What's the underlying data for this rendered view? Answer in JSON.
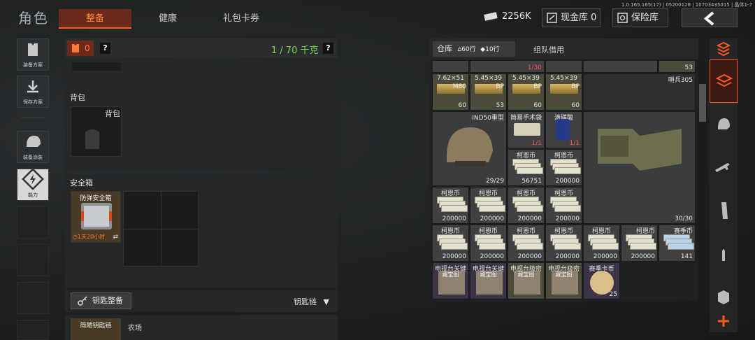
{
  "header": {
    "title": "角色",
    "tabs": [
      {
        "label": "整备",
        "active": true
      },
      {
        "label": "健康",
        "active": false
      },
      {
        "label": "礼包卡券",
        "active": false
      }
    ],
    "money": "2256K",
    "cash_vault_label": "现金库 0",
    "safe_vault_label": "保险库",
    "version": "1.0.165.165(17) | 05200128 | 10703435015 | 晶体1-7"
  },
  "left_nav": [
    {
      "label": "装备方案",
      "icon": "vest-icon"
    },
    {
      "label": "保存方案",
      "icon": "download-icon"
    },
    {
      "label": "装备涂装",
      "icon": "helmet-paint-icon"
    },
    {
      "label": "能力",
      "icon": "lightning-icon"
    }
  ],
  "loadout": {
    "armor_value": "0",
    "weight": "1 / 70 千克",
    "help": "?",
    "backpack_title": "背包",
    "backpack_slot_label": "背包",
    "safe_title": "安全箱",
    "safe_item_name": "防弹安全箱",
    "safe_item_timer": "1天20小时",
    "key_button": "钥匙整备",
    "keychain_label": "钥匙链",
    "key_item_name": "简陋钥匙链",
    "key_item_location": "农场"
  },
  "stash": {
    "tab_label": "仓库",
    "row_count_a": "60行",
    "row_count_b": "10行",
    "squad_tab": "组队借用",
    "row0": [
      {
        "count": ""
      },
      {
        "count": "1/30"
      },
      {
        "count": ""
      },
      {
        "count": "53"
      }
    ],
    "ammo_row": [
      {
        "name": "7.62×51",
        "sub": "M80",
        "count": "60"
      },
      {
        "name": "5.45×39",
        "sub": "BP",
        "count": "53"
      },
      {
        "name": "5.45×39",
        "sub": "BP",
        "count": "60"
      },
      {
        "name": "5.45×39",
        "sub": "BP",
        "count": "60"
      }
    ],
    "sentry_label": "哨兵305",
    "helmet": {
      "name": "IND50重型",
      "count": "29/29"
    },
    "surgery": {
      "name": "简易手术袋",
      "count": "1/1"
    },
    "acid": {
      "name": "滴磺酸",
      "count": "1/1"
    },
    "vest_count": "30/30",
    "cash_row1": [
      {
        "name": "柯恩币",
        "count": "56751"
      },
      {
        "name": "柯恩币",
        "count": "200000"
      }
    ],
    "cash_row2": [
      {
        "name": "柯恩币",
        "count": "200000"
      },
      {
        "name": "柯恩币",
        "count": "200000"
      },
      {
        "name": "柯恩币",
        "count": "200000"
      },
      {
        "name": "柯恩币",
        "count": "200000"
      }
    ],
    "cash_row3": [
      {
        "name": "柯恩币",
        "count": "200000"
      },
      {
        "name": "柯恩币",
        "count": "200000"
      },
      {
        "name": "柯恩币",
        "count": "200000"
      },
      {
        "name": "柯恩币",
        "count": "200000"
      },
      {
        "name": "柯恩币",
        "count": "200000"
      },
      {
        "name": "柯恩币",
        "count": "200000"
      },
      {
        "name": "赛季币",
        "count": "141"
      }
    ],
    "special_row": [
      {
        "name": "电视台关键",
        "sub": "藏宝图"
      },
      {
        "name": "电视台关键",
        "sub": "藏宝图"
      },
      {
        "name": "电视台极密",
        "sub": "藏宝图"
      },
      {
        "name": "电视台极密",
        "sub": "藏宝图"
      },
      {
        "name": "赛季卡币",
        "count": "25"
      }
    ]
  },
  "colors": {
    "accent": "#ff5a1a",
    "weight_green": "#7cd74a",
    "count_red": "#ff5050"
  }
}
